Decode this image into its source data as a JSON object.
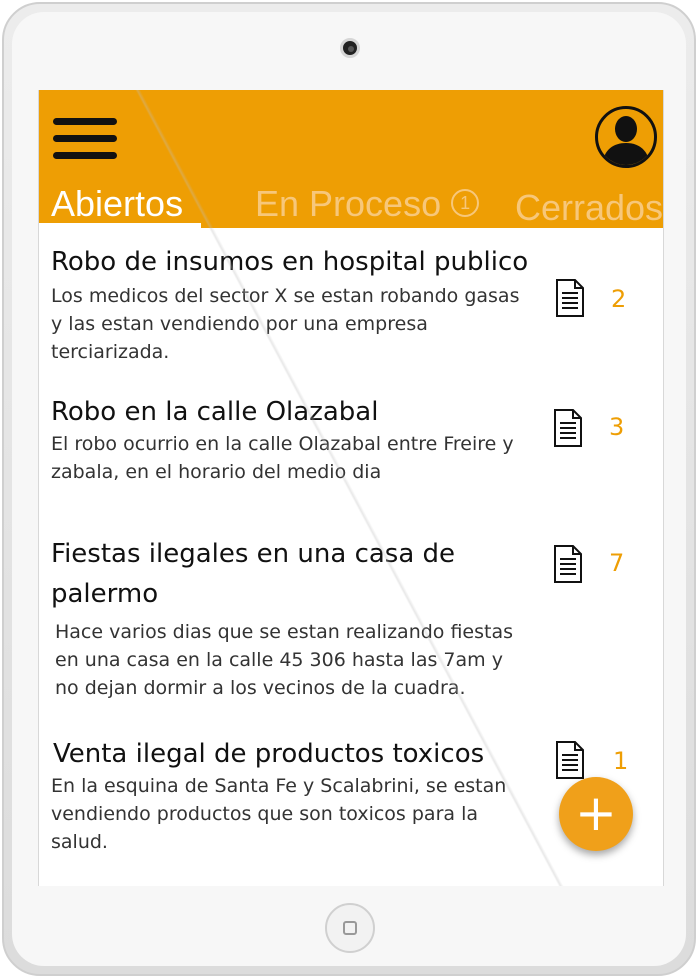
{
  "appbar": {
    "menu_icon": "hamburger-menu-icon",
    "profile_icon": "user-avatar-icon",
    "accent_color": "#ee9e04"
  },
  "tabs": [
    {
      "label": "Abiertos",
      "active": true
    },
    {
      "label": "En Proceso",
      "badge": "1",
      "active": false
    },
    {
      "label": "Cerrados",
      "active": false
    }
  ],
  "reports": [
    {
      "title": "Robo de insumos en hospital publico",
      "description": "Los medicos del sector X se estan robando gasas y las estan vendiendo por una empresa terciarizada.",
      "count": "2",
      "icon": "document-icon"
    },
    {
      "title": "Robo en la calle Olazabal",
      "description": "El robo ocurrio en la calle Olazabal entre Freire y zabala, en el horario del medio dia",
      "count": "3",
      "icon": "document-icon"
    },
    {
      "title_line1": "Fiestas ilegales en una casa de",
      "title_line2": "palermo",
      "description": "Hace varios dias que se estan realizando fiestas en una casa en la calle 45 306 hasta las 7am y no dejan dormir a los vecinos de la cuadra.",
      "count": "7",
      "icon": "document-icon"
    },
    {
      "title": "Venta ilegal de productos toxicos",
      "description": "En la esquina de Santa Fe y Scalabrini, se estan vendiendo productos que son toxicos para la salud.",
      "count": "1",
      "icon": "document-icon"
    }
  ],
  "fab": {
    "label": "+",
    "icon": "plus-icon"
  }
}
